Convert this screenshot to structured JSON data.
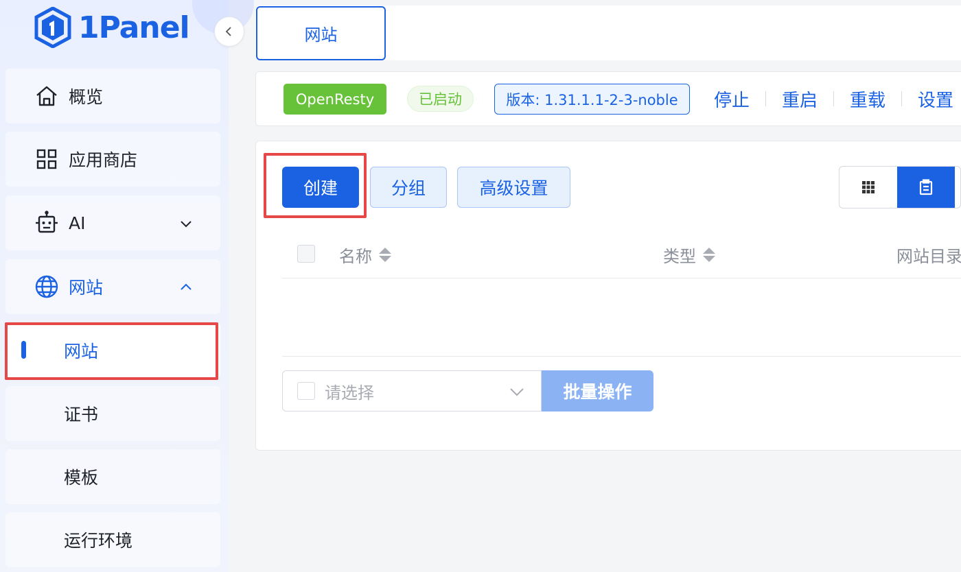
{
  "brand": {
    "name": "1Panel",
    "accent": "#1b62e3"
  },
  "sidebar": {
    "items": [
      {
        "label": "概览",
        "icon": "home-icon"
      },
      {
        "label": "应用商店",
        "icon": "apps-grid-icon"
      },
      {
        "label": "AI",
        "icon": "robot-icon",
        "expanded": false
      },
      {
        "label": "网站",
        "icon": "globe-icon",
        "expanded": true
      }
    ],
    "subitems": [
      {
        "label": "网站",
        "active": true
      },
      {
        "label": "证书"
      },
      {
        "label": "模板"
      },
      {
        "label": "运行环境"
      }
    ]
  },
  "tabs": {
    "active": "网站"
  },
  "app_status": {
    "app_name": "OpenResty",
    "state": "已启动",
    "version": "版本: 1.31.1.1-2-3-noble",
    "actions": [
      "停止",
      "重启",
      "重载",
      "设置"
    ],
    "colors": {
      "app_tag": "#67c23a",
      "state": "#67c23a"
    }
  },
  "toolbar": {
    "create": "创建",
    "group": "分组",
    "advanced": "高级设置"
  },
  "table": {
    "columns": [
      "名称",
      "类型",
      "网站目录"
    ]
  },
  "batch": {
    "placeholder": "请选择",
    "button": "批量操作"
  }
}
